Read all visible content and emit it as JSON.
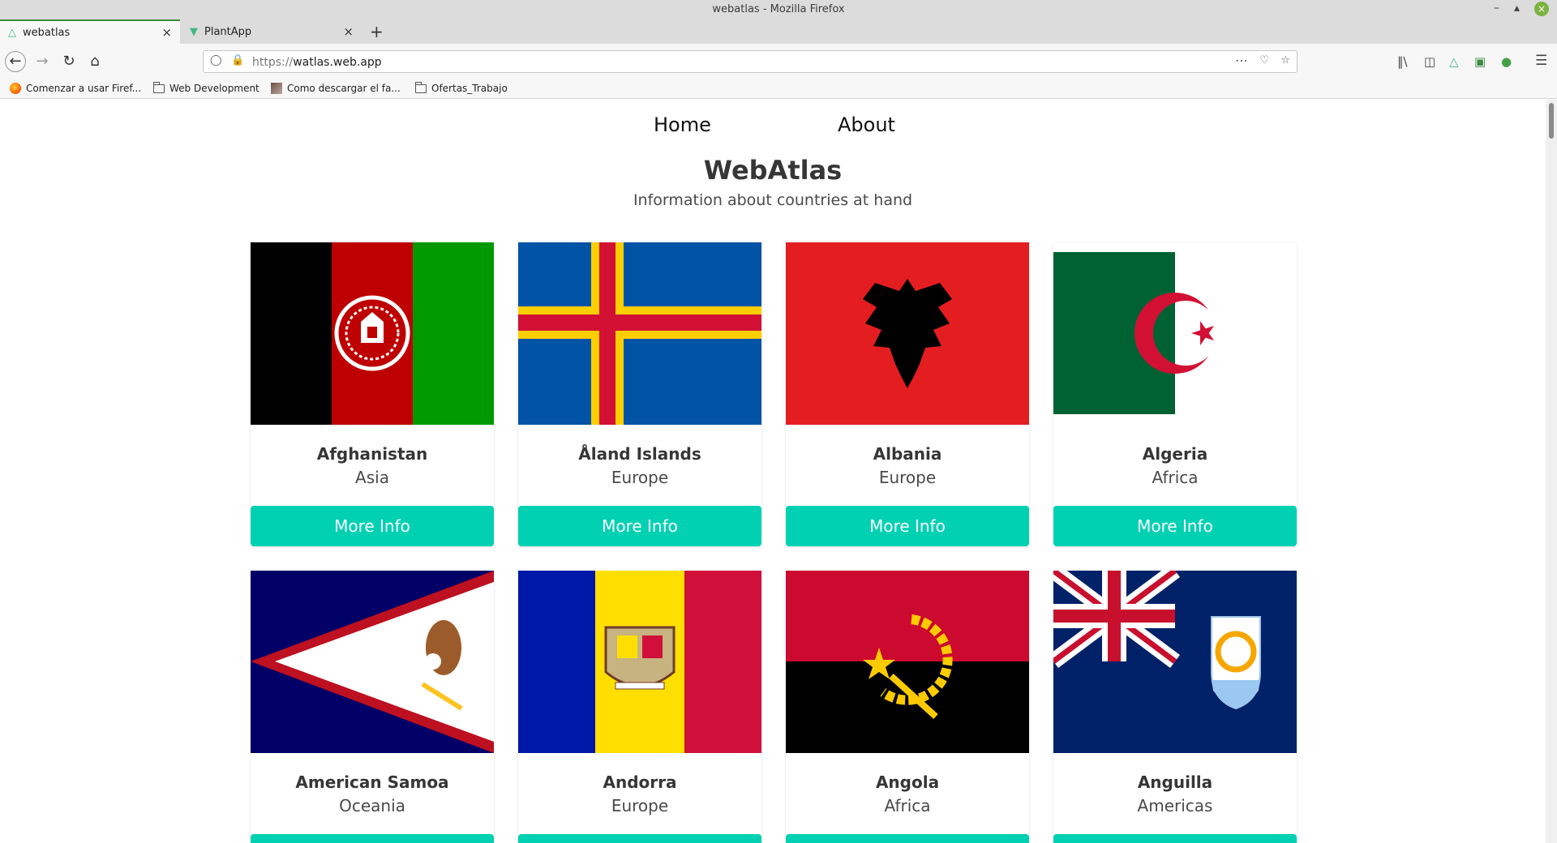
{
  "window": {
    "title": "webatlas - Mozilla Firefox"
  },
  "tabs": [
    {
      "label": "webatlas",
      "icon": "vue-logo-icon",
      "active": true
    },
    {
      "label": "PlantApp",
      "icon": "vue-logo-icon",
      "active": false
    }
  ],
  "toolbar": {
    "url_protocol": "https://",
    "url_host": "watlas.web.app"
  },
  "bookmarks": [
    {
      "label": "Comenzar a usar Firef...",
      "icon": "firefox-icon"
    },
    {
      "label": "Web Development",
      "icon": "folder-icon"
    },
    {
      "label": "Como descargar el fa...",
      "icon": "image-icon"
    },
    {
      "label": "Ofertas_Trabajo",
      "icon": "folder-icon"
    }
  ],
  "site": {
    "nav": {
      "home": "Home",
      "about": "About"
    },
    "title": "WebAtlas",
    "subtitle": "Information about countries at hand",
    "more_info_label": "More Info",
    "accent_color": "#00d1b2"
  },
  "countries": [
    {
      "name": "Afghanistan",
      "region": "Asia",
      "flag": "afghanistan-flag"
    },
    {
      "name": "Åland Islands",
      "region": "Europe",
      "flag": "aland-islands-flag"
    },
    {
      "name": "Albania",
      "region": "Europe",
      "flag": "albania-flag"
    },
    {
      "name": "Algeria",
      "region": "Africa",
      "flag": "algeria-flag"
    },
    {
      "name": "American Samoa",
      "region": "Oceania",
      "flag": "american-samoa-flag"
    },
    {
      "name": "Andorra",
      "region": "Europe",
      "flag": "andorra-flag"
    },
    {
      "name": "Angola",
      "region": "Africa",
      "flag": "angola-flag"
    },
    {
      "name": "Anguilla",
      "region": "Americas",
      "flag": "anguilla-flag"
    }
  ]
}
